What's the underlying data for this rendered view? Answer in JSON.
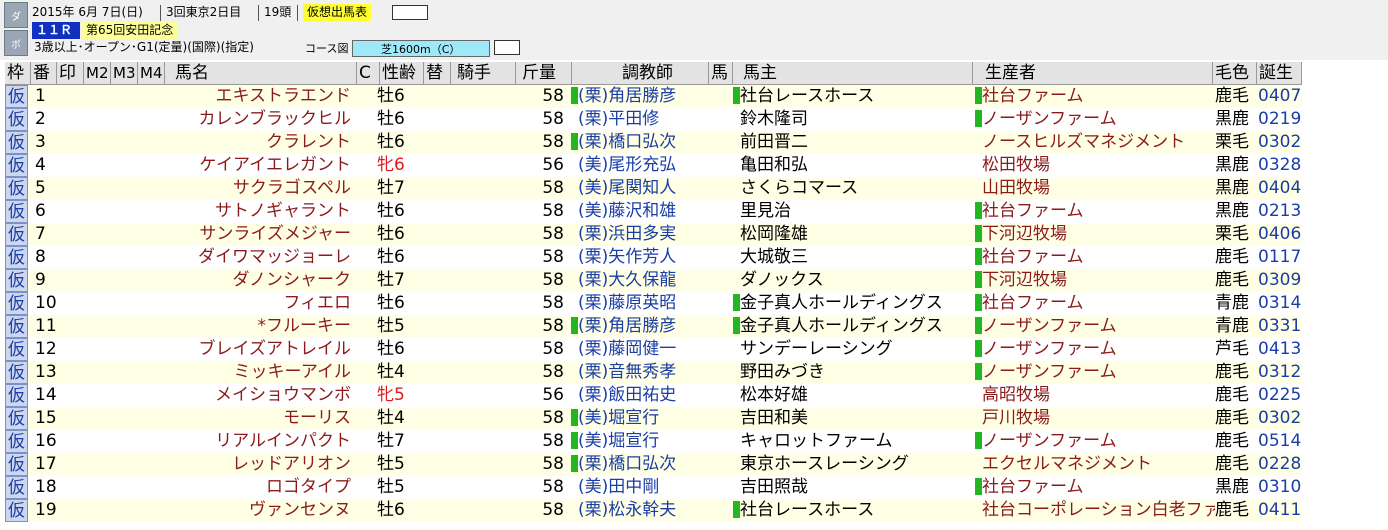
{
  "header": {
    "side_tabs": [
      "ダ",
      "ボ"
    ],
    "date": "2015年  6月  7日(日)",
    "meeting": "3回東京2日目",
    "field_size": "19頭",
    "mode_label": "仮想出馬表",
    "race_no": "１１Ｒ",
    "race_name": "第65回安田記念",
    "conditions": "3歳以上･オープン･G1(定量)(国際)(指定)",
    "course_label": "コース図",
    "course": "芝1600m（C）"
  },
  "table": {
    "columns": [
      "枠",
      "番",
      "印",
      "M2",
      "M3",
      "M4",
      "馬名",
      "C",
      "性齢",
      "替",
      "騎手",
      "斤量",
      "調教師",
      "馬",
      "馬主",
      "生産者",
      "毛色",
      "誕生"
    ],
    "rows": [
      {
        "waku": "仮",
        "num": "1",
        "name": "エキストラエンド",
        "sexage": "牡6",
        "female": false,
        "weight": "58",
        "trainer_mark": true,
        "trainer": "(栗)角居勝彦",
        "owner_mark": true,
        "owner": "社台レースホース",
        "breeder_mark": true,
        "breeder": "社台ファーム",
        "color": "鹿毛",
        "birth": "0407"
      },
      {
        "waku": "仮",
        "num": "2",
        "name": "カレンブラックヒル",
        "sexage": "牡6",
        "female": false,
        "weight": "58",
        "trainer_mark": false,
        "trainer": "(栗)平田修",
        "owner_mark": false,
        "owner": "鈴木隆司",
        "breeder_mark": true,
        "breeder": "ノーザンファーム",
        "color": "黒鹿",
        "birth": "0219"
      },
      {
        "waku": "仮",
        "num": "3",
        "name": "クラレント",
        "sexage": "牡6",
        "female": false,
        "weight": "58",
        "trainer_mark": true,
        "trainer": "(栗)橋口弘次",
        "owner_mark": false,
        "owner": "前田晋二",
        "breeder_mark": false,
        "breeder": "ノースヒルズマネジメント",
        "color": "栗毛",
        "birth": "0302"
      },
      {
        "waku": "仮",
        "num": "4",
        "name": "ケイアイエレガント",
        "sexage": "牝6",
        "female": true,
        "weight": "56",
        "trainer_mark": false,
        "trainer": "(美)尾形充弘",
        "owner_mark": false,
        "owner": "亀田和弘",
        "breeder_mark": false,
        "breeder": "松田牧場",
        "color": "黒鹿",
        "birth": "0328"
      },
      {
        "waku": "仮",
        "num": "5",
        "name": "サクラゴスペル",
        "sexage": "牡7",
        "female": false,
        "weight": "58",
        "trainer_mark": false,
        "trainer": "(美)尾関知人",
        "owner_mark": false,
        "owner": "さくらコマース",
        "breeder_mark": false,
        "breeder": "山田牧場",
        "color": "黒鹿",
        "birth": "0404"
      },
      {
        "waku": "仮",
        "num": "6",
        "name": "サトノギャラント",
        "sexage": "牡6",
        "female": false,
        "weight": "58",
        "trainer_mark": false,
        "trainer": "(美)藤沢和雄",
        "owner_mark": false,
        "owner": "里見治",
        "breeder_mark": true,
        "breeder": "社台ファーム",
        "color": "黒鹿",
        "birth": "0213"
      },
      {
        "waku": "仮",
        "num": "7",
        "name": "サンライズメジャー",
        "sexage": "牡6",
        "female": false,
        "weight": "58",
        "trainer_mark": false,
        "trainer": "(栗)浜田多実",
        "owner_mark": false,
        "owner": "松岡隆雄",
        "breeder_mark": true,
        "breeder": "下河辺牧場",
        "color": "栗毛",
        "birth": "0406"
      },
      {
        "waku": "仮",
        "num": "8",
        "name": "ダイワマッジョーレ",
        "sexage": "牡6",
        "female": false,
        "weight": "58",
        "trainer_mark": false,
        "trainer": "(栗)矢作芳人",
        "owner_mark": false,
        "owner": "大城敬三",
        "breeder_mark": true,
        "breeder": "社台ファーム",
        "color": "鹿毛",
        "birth": "0117"
      },
      {
        "waku": "仮",
        "num": "9",
        "name": "ダノンシャーク",
        "sexage": "牡7",
        "female": false,
        "weight": "58",
        "trainer_mark": false,
        "trainer": "(栗)大久保龍",
        "owner_mark": false,
        "owner": "ダノックス",
        "breeder_mark": true,
        "breeder": "下河辺牧場",
        "color": "鹿毛",
        "birth": "0309"
      },
      {
        "waku": "仮",
        "num": "10",
        "name": "フィエロ",
        "sexage": "牡6",
        "female": false,
        "weight": "58",
        "trainer_mark": false,
        "trainer": "(栗)藤原英昭",
        "owner_mark": true,
        "owner": "金子真人ホールディングス",
        "breeder_mark": true,
        "breeder": "社台ファーム",
        "color": "青鹿",
        "birth": "0314"
      },
      {
        "waku": "仮",
        "num": "11",
        "name": "*フルーキー",
        "sexage": "牡5",
        "female": false,
        "weight": "58",
        "trainer_mark": true,
        "trainer": "(栗)角居勝彦",
        "owner_mark": true,
        "owner": "金子真人ホールディングス",
        "breeder_mark": true,
        "breeder": "ノーザンファーム",
        "color": "青鹿",
        "birth": "0331"
      },
      {
        "waku": "仮",
        "num": "12",
        "name": "ブレイズアトレイル",
        "sexage": "牡6",
        "female": false,
        "weight": "58",
        "trainer_mark": false,
        "trainer": "(栗)藤岡健一",
        "owner_mark": false,
        "owner": "サンデーレーシング",
        "breeder_mark": true,
        "breeder": "ノーザンファーム",
        "color": "芦毛",
        "birth": "0413"
      },
      {
        "waku": "仮",
        "num": "13",
        "name": "ミッキーアイル",
        "sexage": "牡4",
        "female": false,
        "weight": "58",
        "trainer_mark": false,
        "trainer": "(栗)音無秀孝",
        "owner_mark": false,
        "owner": "野田みづき",
        "breeder_mark": true,
        "breeder": "ノーザンファーム",
        "color": "鹿毛",
        "birth": "0312"
      },
      {
        "waku": "仮",
        "num": "14",
        "name": "メイショウマンボ",
        "sexage": "牝5",
        "female": true,
        "weight": "56",
        "trainer_mark": false,
        "trainer": "(栗)飯田祐史",
        "owner_mark": false,
        "owner": "松本好雄",
        "breeder_mark": false,
        "breeder": "高昭牧場",
        "color": "鹿毛",
        "birth": "0225"
      },
      {
        "waku": "仮",
        "num": "15",
        "name": "モーリス",
        "sexage": "牡4",
        "female": false,
        "weight": "58",
        "trainer_mark": true,
        "trainer": "(美)堀宣行",
        "owner_mark": false,
        "owner": "吉田和美",
        "breeder_mark": false,
        "breeder": "戸川牧場",
        "color": "鹿毛",
        "birth": "0302"
      },
      {
        "waku": "仮",
        "num": "16",
        "name": "リアルインパクト",
        "sexage": "牡7",
        "female": false,
        "weight": "58",
        "trainer_mark": true,
        "trainer": "(美)堀宣行",
        "owner_mark": false,
        "owner": "キャロットファーム",
        "breeder_mark": true,
        "breeder": "ノーザンファーム",
        "color": "鹿毛",
        "birth": "0514"
      },
      {
        "waku": "仮",
        "num": "17",
        "name": "レッドアリオン",
        "sexage": "牡5",
        "female": false,
        "weight": "58",
        "trainer_mark": true,
        "trainer": "(栗)橋口弘次",
        "owner_mark": false,
        "owner": "東京ホースレーシング",
        "breeder_mark": false,
        "breeder": "エクセルマネジメント",
        "color": "鹿毛",
        "birth": "0228"
      },
      {
        "waku": "仮",
        "num": "18",
        "name": "ロゴタイプ",
        "sexage": "牡5",
        "female": false,
        "weight": "58",
        "trainer_mark": false,
        "trainer": "(美)田中剛",
        "owner_mark": false,
        "owner": "吉田照哉",
        "breeder_mark": true,
        "breeder": "社台ファーム",
        "color": "黒鹿",
        "birth": "0310"
      },
      {
        "waku": "仮",
        "num": "19",
        "name": "ヴァンセンヌ",
        "sexage": "牡6",
        "female": false,
        "weight": "58",
        "trainer_mark": false,
        "trainer": "(栗)松永幹夫",
        "owner_mark": true,
        "owner": "社台レースホース",
        "breeder_mark": false,
        "breeder": "社台コーポレーション白老ファー",
        "color": "鹿毛",
        "birth": "0411"
      }
    ]
  },
  "colors": {
    "accent_blue": "#1a3da6",
    "name_red": "#8b1a1a",
    "female_red": "#e01b1b",
    "mark_green": "#22b722",
    "race_no_bg": "#1030c0",
    "mode_label_bg": "#ffff33",
    "course_bg": "#9ee8f8"
  }
}
